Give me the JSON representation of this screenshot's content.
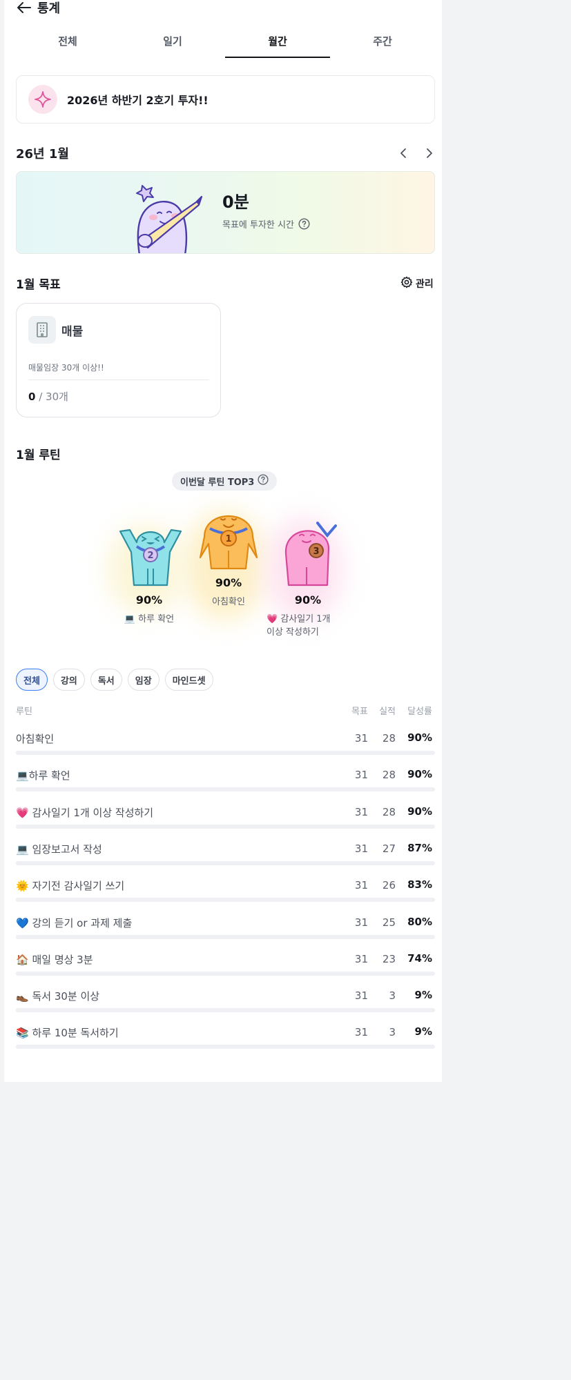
{
  "header": {
    "title": "통계"
  },
  "tabs": [
    {
      "label": "전체",
      "active": false
    },
    {
      "label": "일기",
      "active": false
    },
    {
      "label": "월간",
      "active": true
    },
    {
      "label": "주간",
      "active": false
    }
  ],
  "goal_banner": {
    "text": "2026년 하반기 2호기 투자!!",
    "icon": "sparkle-icon"
  },
  "month": {
    "label": "26년 1월"
  },
  "time_card": {
    "value": "0분",
    "caption": "목표에 투자한 시간"
  },
  "goals": {
    "title": "1월 목표",
    "manage_label": "관리",
    "card": {
      "name": "매물",
      "description": "매물임장 30개 이상!!",
      "current": "0",
      "target": "/ 30개",
      "icon": "building-icon"
    }
  },
  "routines": {
    "title": "1월 루틴",
    "top3_label": "이번달 루틴 TOP3",
    "top3": [
      {
        "rank": 1,
        "percent": "90%",
        "name": "아침확인",
        "color": "#f5a623"
      },
      {
        "rank": 2,
        "percent": "90%",
        "name": "💻 하루 확언",
        "color": "#5fd0d8"
      },
      {
        "rank": 3,
        "percent": "90%",
        "name": "💗 감사일기 1개",
        "name2": "이상 작성하기",
        "color": "#f58fc8"
      }
    ],
    "filters": [
      {
        "label": "전체",
        "active": true
      },
      {
        "label": "강의",
        "active": false
      },
      {
        "label": "독서",
        "active": false
      },
      {
        "label": "임장",
        "active": false
      },
      {
        "label": "마인드셋",
        "active": false
      }
    ],
    "columns": {
      "name": "루틴",
      "target": "목표",
      "actual": "실적",
      "rate": "달성률"
    },
    "rows": [
      {
        "name": "아침확인",
        "target": "31",
        "actual": "28",
        "rate": "90%",
        "fill": 0.9
      },
      {
        "name": "💻하루 확언",
        "target": "31",
        "actual": "28",
        "rate": "90%",
        "fill": 0.9
      },
      {
        "name": "💗 감사일기 1개 이상 작성하기",
        "target": "31",
        "actual": "28",
        "rate": "90%",
        "fill": 0.9
      },
      {
        "name": "💻 임장보고서 작성",
        "target": "31",
        "actual": "27",
        "rate": "87%",
        "fill": 0.87
      },
      {
        "name": "🌞 자기전 감사일기 쓰기",
        "target": "31",
        "actual": "26",
        "rate": "83%",
        "fill": 0.83
      },
      {
        "name": "💙 강의 듣기 or 과제 제출",
        "target": "31",
        "actual": "25",
        "rate": "80%",
        "fill": 0.8
      },
      {
        "name": "🏠 매일 명상 3분",
        "target": "31",
        "actual": "23",
        "rate": "74%",
        "fill": 0.74
      },
      {
        "name": "👞 독서 30분 이상",
        "target": "31",
        "actual": "3",
        "rate": "9%",
        "fill": 0.09
      },
      {
        "name": "📚 하루 10분 독서하기",
        "target": "31",
        "actual": "3",
        "rate": "9%",
        "fill": 0.09
      }
    ]
  }
}
